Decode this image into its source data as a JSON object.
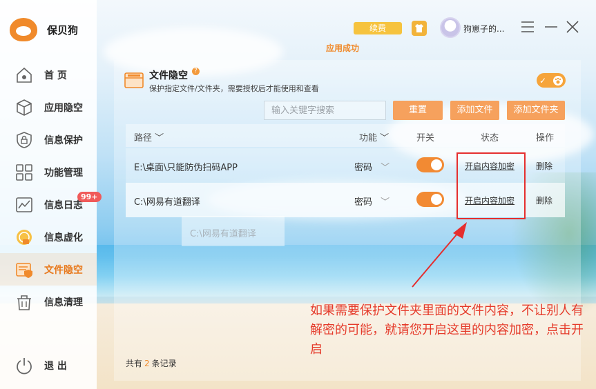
{
  "app": {
    "name": "保贝狗"
  },
  "sidebar": {
    "items": [
      {
        "label": "首 页",
        "icon": "home-icon"
      },
      {
        "label": "应用隐空",
        "icon": "cube-icon"
      },
      {
        "label": "信息保护",
        "icon": "shield-lock-icon"
      },
      {
        "label": "功能管理",
        "icon": "grid-icon"
      },
      {
        "label": "信息日志",
        "icon": "chart-icon",
        "badge": "99+"
      },
      {
        "label": "信息虚化",
        "icon": "coin-icon"
      },
      {
        "label": "文件隐空",
        "icon": "folder-shield-icon",
        "active": true
      },
      {
        "label": "信息清理",
        "icon": "trash-icon"
      }
    ],
    "exit_label": "退 出"
  },
  "topbar": {
    "renew_label": "续费",
    "username": "狗崽子的...",
    "toast": "应用成功"
  },
  "page": {
    "title": "文件隐空",
    "help_mark": "?",
    "subtitle": "保护指定文件/文件夹，需要授权后才能使用和查看",
    "master_toggle_mark": "✓"
  },
  "toolbar": {
    "search_placeholder": "输入关键字搜索",
    "reset_label": "重置",
    "add_file_label": "添加文件",
    "add_folder_label": "添加文件夹"
  },
  "table": {
    "headers": {
      "path": "路径",
      "function": "功能",
      "switch": "开关",
      "status": "状态",
      "action": "操作"
    },
    "rows": [
      {
        "path": "E:\\桌面\\只能防伪扫码APP",
        "function": "密码",
        "switch_on": true,
        "status_link": "开启内容加密",
        "action": "删除"
      },
      {
        "path": "C:\\网易有道翻译",
        "function": "密码",
        "switch_on": true,
        "status_link": "开启内容加密",
        "action": "删除"
      }
    ],
    "drag_ghost": "C:\\网易有道翻译"
  },
  "footer": {
    "prefix": "共有",
    "count": "2",
    "suffix": "条记录"
  },
  "annotation": {
    "text": "如果需要保护文件夹里面的文件内容，不让别人有解密的可能，就请您开启这里的内容加密，点击开启",
    "color": "#e53a2a"
  },
  "colors": {
    "accent": "#f08a2b",
    "button": "#f6a15d",
    "toggle": "#f28a33",
    "highlight": "#e52e2e"
  }
}
